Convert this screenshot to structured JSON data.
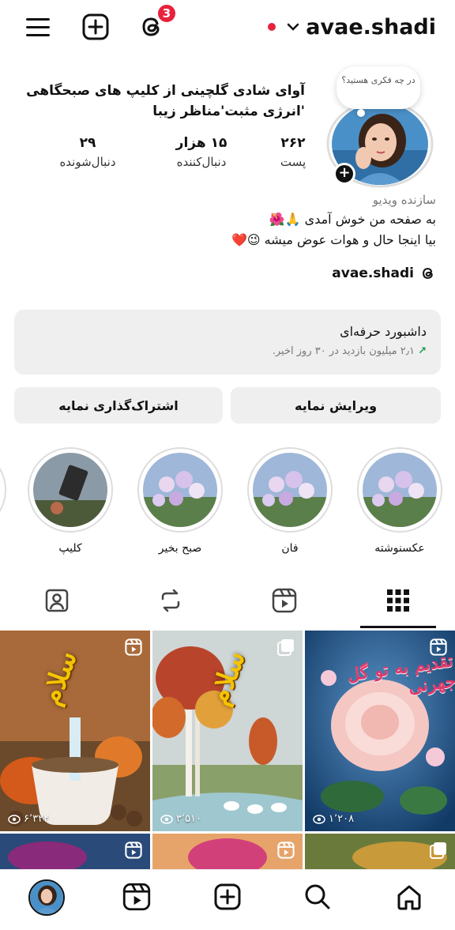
{
  "topbar": {
    "username": "avae.shadi",
    "badge_count": "3",
    "icons": [
      "menu-icon",
      "create-icon",
      "threads-icon",
      "chevron-down-icon"
    ]
  },
  "note": {
    "text": "در چه فکری هستید؟"
  },
  "profile": {
    "display_name": "آوای شادی گلچینی از کلیپ های صبحگاهی 'انرژی مثبت'مناظر زیبا",
    "stats": {
      "posts": {
        "value": "۲۶۲",
        "label": "پست"
      },
      "followers": {
        "value": "۱۵ هزار",
        "label": "دنبال‌کننده"
      },
      "following": {
        "value": "۲۹",
        "label": "دنبال‌شونده"
      }
    },
    "category": "سازنده ویدیو",
    "bio_line1": "به صفحه من خوش آمدی 🙏🌺",
    "bio_line2": "بیا اینجا حال و هوات عوض میشه 😉❤️",
    "threads_handle": "avae.shadi"
  },
  "dashboard": {
    "title": "داشبورد حرفه‌ای",
    "subtitle": "۲٫۱ میلیون بازدید در ۳۰ روز اخیر.",
    "arrow": "↗"
  },
  "buttons": {
    "edit": "ویرایش نمایه",
    "share": "اشتراک‌گذاری نمایه"
  },
  "highlights": [
    {
      "label": "عکسنوشته"
    },
    {
      "label": "فان"
    },
    {
      "label": "صبح بخیر"
    },
    {
      "label": "کلیپ"
    }
  ],
  "tabs": [
    "grid-icon",
    "reels-icon",
    "reposts-icon",
    "tagged-icon"
  ],
  "grid": [
    {
      "caption": "تقدیم به تو گل جهرنی",
      "views": "۱٬۲۰۸",
      "type": "reel"
    },
    {
      "caption": "سلام",
      "views": "۳٬۵۱۰",
      "type": "carousel"
    },
    {
      "caption": "سلام",
      "views": "۶٬۳۲۴",
      "type": "reel"
    }
  ],
  "bottom_nav": [
    "home-icon",
    "search-icon",
    "create-icon",
    "reels-icon",
    "profile-avatar"
  ],
  "colors": {
    "accent_red": "#e8213e",
    "bg_light": "#efefef",
    "trend_green": "#1a9e4a"
  }
}
